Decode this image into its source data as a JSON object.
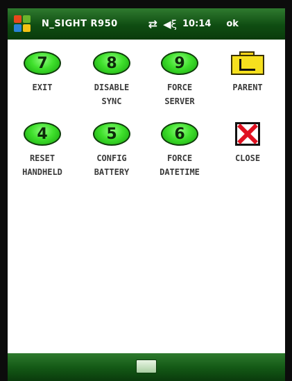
{
  "status_bar": {
    "app_title": "N_SIGHT R950",
    "sync_icon": "⇄",
    "volume_icon": "◀ξ",
    "time": "10:14",
    "ok_label": "ok"
  },
  "tiles": [
    {
      "number": "7",
      "label_line1": "EXIT",
      "label_line2": ""
    },
    {
      "number": "8",
      "label_line1": "DISABLE",
      "label_line2": "SYNC"
    },
    {
      "number": "9",
      "label_line1": "FORCE",
      "label_line2": "SERVER"
    },
    {
      "icon": "folder-up-icon",
      "label_line1": "PARENT",
      "label_line2": ""
    },
    {
      "number": "4",
      "label_line1": "RESET",
      "label_line2": "HANDHELD"
    },
    {
      "number": "5",
      "label_line1": "CONFIG",
      "label_line2": "BATTERY"
    },
    {
      "number": "6",
      "label_line1": "FORCE",
      "label_line2": "DATETIME"
    },
    {
      "icon": "close-icon",
      "label_line1": "CLOSE",
      "label_line2": ""
    }
  ],
  "colors": {
    "title_bar": "#0f4d12",
    "button_green": "#3fe02c",
    "folder_yellow": "#f6e01e",
    "close_red": "#e01020"
  },
  "bottom_bar": {
    "keyboard_icon": "keyboard-icon"
  }
}
